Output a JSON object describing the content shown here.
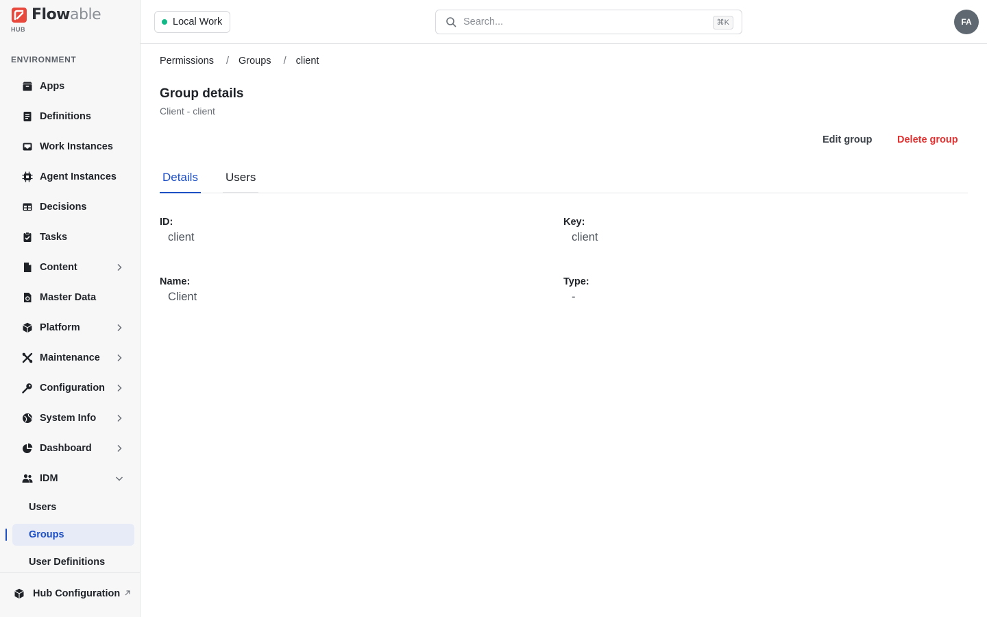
{
  "brand": {
    "name_bold": "Flow",
    "name_light": "able",
    "sub": "HUB"
  },
  "sidebar": {
    "section_label": "ENVIRONMENT",
    "items": [
      {
        "label": "Apps",
        "icon": "box-icon",
        "chevron": false
      },
      {
        "label": "Definitions",
        "icon": "document-icon",
        "chevron": false
      },
      {
        "label": "Work Instances",
        "icon": "inbox-icon",
        "chevron": false
      },
      {
        "label": "Agent Instances",
        "icon": "chip-icon",
        "chevron": false
      },
      {
        "label": "Decisions",
        "icon": "table-icon",
        "chevron": false
      },
      {
        "label": "Tasks",
        "icon": "clipboard-check-icon",
        "chevron": false
      },
      {
        "label": "Content",
        "icon": "file-icon",
        "chevron": true
      },
      {
        "label": "Master Data",
        "icon": "database-file-icon",
        "chevron": false
      },
      {
        "label": "Platform",
        "icon": "cube-icon",
        "chevron": true
      },
      {
        "label": "Maintenance",
        "icon": "tools-icon",
        "chevron": true
      },
      {
        "label": "Configuration",
        "icon": "key-icon",
        "chevron": true
      },
      {
        "label": "System Info",
        "icon": "globe-icon",
        "chevron": true
      },
      {
        "label": "Dashboard",
        "icon": "pie-chart-icon",
        "chevron": true
      },
      {
        "label": "IDM",
        "icon": "users-icon",
        "chevron": "down"
      }
    ],
    "idm_sub_items": [
      {
        "label": "Users",
        "active": false
      },
      {
        "label": "Groups",
        "active": true
      },
      {
        "label": "User Definitions",
        "active": false
      }
    ],
    "footer": {
      "label": "Hub Configuration"
    }
  },
  "header": {
    "environment": "Local Work",
    "environment_status_color": "#12b886",
    "search_placeholder": "Search...",
    "search_shortcut": "⌘K",
    "avatar_initials": "FA"
  },
  "breadcrumb": [
    "Permissions",
    "Groups",
    "client"
  ],
  "page": {
    "title": "Group details",
    "subtitle": "Client - client",
    "actions": {
      "edit": "Edit group",
      "delete": "Delete group"
    },
    "tabs": [
      {
        "label": "Details",
        "active": true
      },
      {
        "label": "Users",
        "active": false
      }
    ],
    "fields": {
      "id": {
        "label": "ID:",
        "value": "client"
      },
      "key": {
        "label": "Key:",
        "value": "client"
      },
      "name": {
        "label": "Name:",
        "value": "Client"
      },
      "type": {
        "label": "Type:",
        "value": "-"
      }
    }
  },
  "colors": {
    "accent": "#1d4fc4",
    "danger": "#e03131",
    "active_bg": "#e6ebf7"
  }
}
